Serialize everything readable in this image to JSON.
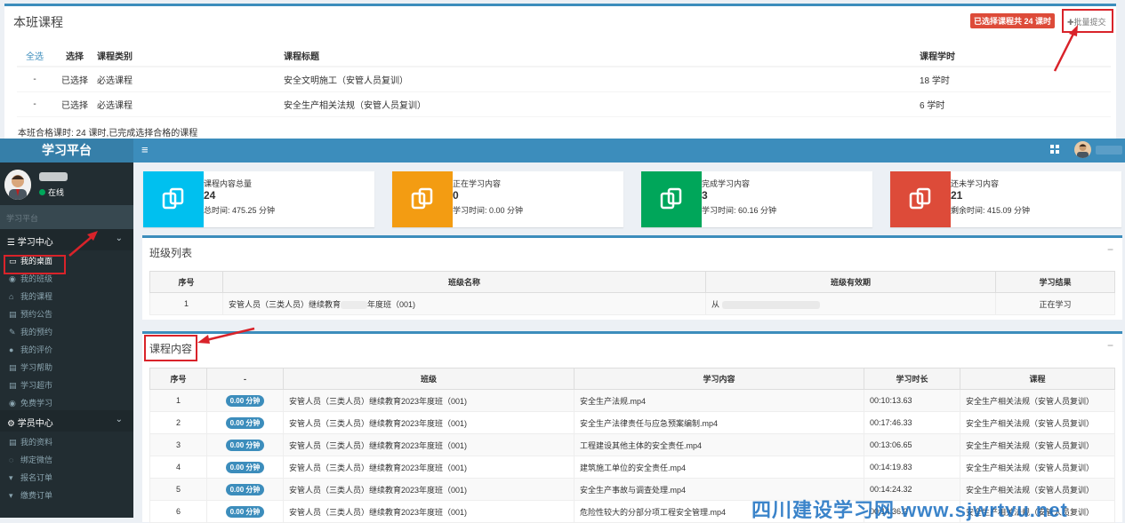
{
  "top_panel": {
    "title": "本班课程",
    "badge": "已选择课程共 24 课时",
    "batch_submit": "批量提交",
    "headers": [
      "全选",
      "选择",
      "课程类别",
      "课程标题",
      "课程学时"
    ],
    "rows": [
      [
        "-",
        "已选择",
        "必选课程",
        "安全文明施工（安管人员复训）",
        "18 学时"
      ],
      [
        "-",
        "已选择",
        "必选课程",
        "安全生产相关法规（安管人员复训）",
        "6 学时"
      ]
    ],
    "summary": "本班合格课时: 24 课时,已完成选择合格的课程"
  },
  "header": {
    "logo": "学习平台",
    "menu_icon": "hamburger-icon",
    "grid_icon": "grid-icon"
  },
  "sidebar": {
    "status": "在线",
    "search_hint": "学习平台",
    "section1": "学习中心",
    "items1": [
      {
        "label": "我的桌面",
        "icon": "desktop-icon"
      },
      {
        "label": "我的班级",
        "icon": "circle-icon"
      },
      {
        "label": "我的课程",
        "icon": "graduation-cap-icon"
      },
      {
        "label": "预约公告",
        "icon": "file-icon"
      },
      {
        "label": "我的预约",
        "icon": "edit-icon"
      },
      {
        "label": "我的评价",
        "icon": "comments-icon"
      },
      {
        "label": "学习帮助",
        "icon": "file-icon"
      },
      {
        "label": "学习超市",
        "icon": "file-icon"
      },
      {
        "label": "免费学习",
        "icon": "circle-icon"
      }
    ],
    "section2": "学员中心",
    "items2": [
      {
        "label": "我的资料",
        "icon": "file-icon"
      },
      {
        "label": "绑定微信",
        "icon": "wechat-icon"
      },
      {
        "label": "报名订单",
        "icon": "cart-icon"
      },
      {
        "label": "缴费订单",
        "icon": "cart-icon"
      }
    ]
  },
  "info_boxes": [
    {
      "label": "课程内容总量",
      "number": "24",
      "sub": "总时间: 475.25 分钟",
      "color": "#00c0ef"
    },
    {
      "label": "正在学习内容",
      "number": "0",
      "sub": "学习时间: 0.00 分钟",
      "color": "#f39c12"
    },
    {
      "label": "完成学习内容",
      "number": "3",
      "sub": "学习时间: 60.16 分钟",
      "color": "#00a65a"
    },
    {
      "label": "还未学习内容",
      "number": "21",
      "sub": "剩余时间: 415.09 分钟",
      "color": "#dd4b39"
    }
  ],
  "class_list": {
    "title": "班级列表",
    "headers": [
      "序号",
      "班级名称",
      "班级有效期",
      "学习结果"
    ],
    "row": {
      "no": "1",
      "name_a": "安管人员（三类人员）继续教育",
      "name_b": "年度班（001)",
      "validity": "从",
      "result": "正在学习"
    }
  },
  "course_content": {
    "title": "课程内容",
    "headers": [
      "序号",
      "-",
      "班级",
      "学习内容",
      "学习时长",
      "课程"
    ],
    "rows": [
      {
        "no": "1",
        "badge": "0.00 分钟",
        "class": "安管人员（三类人员）继续教育2023年度班（001)",
        "content": "安全生产法规.mp4",
        "duration": "00:10:13.63",
        "course": "安全生产相关法规（安管人员复训）"
      },
      {
        "no": "2",
        "badge": "0.00 分钟",
        "class": "安管人员（三类人员）继续教育2023年度班（001)",
        "content": "安全生产法律责任与应急预案编制.mp4",
        "duration": "00:17:46.33",
        "course": "安全生产相关法规（安管人员复训）"
      },
      {
        "no": "3",
        "badge": "0.00 分钟",
        "class": "安管人员（三类人员）继续教育2023年度班（001)",
        "content": "工程建设其他主体的安全责任.mp4",
        "duration": "00:13:06.65",
        "course": "安全生产相关法规（安管人员复训）"
      },
      {
        "no": "4",
        "badge": "0.00 分钟",
        "class": "安管人员（三类人员）继续教育2023年度班（001)",
        "content": "建筑施工单位的安全责任.mp4",
        "duration": "00:14:19.83",
        "course": "安全生产相关法规（安管人员复训）"
      },
      {
        "no": "5",
        "badge": "0.00 分钟",
        "class": "安管人员（三类人员）继续教育2023年度班（001)",
        "content": "安全生产事故与调查处理.mp4",
        "duration": "00:14:24.32",
        "course": "安全生产相关法规（安管人员复训）"
      },
      {
        "no": "6",
        "badge": "0.00 分钟",
        "class": "安管人员（三类人员）继续教育2023年度班（001)",
        "content": "危险性较大的分部分项工程安全管理.mp4",
        "duration": "00:14:36.2",
        "course": "安全生产相关法规（安管人员复训）"
      }
    ]
  },
  "watermark": "四川建设学习网 www.sjwrtvu.net"
}
